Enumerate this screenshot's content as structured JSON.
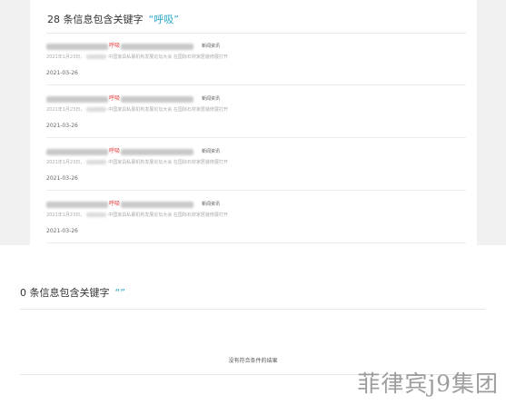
{
  "section1": {
    "count_label": "28 条信息包含关键字",
    "keyword": "“呼吸”"
  },
  "results": [
    {
      "highlight": "呼吸",
      "category": "新闻资讯",
      "snippet_start": "2021年1月23日，",
      "snippet_mid": "中国家具私募机构发展论坛大会",
      "snippet_end": "在国际石材家居装修展打开",
      "date": "2021-03-26"
    },
    {
      "highlight": "呼吸",
      "category": "新闻资讯",
      "snippet_start": "2021年1月23日，",
      "snippet_mid": "中国家具私募机构发展论坛大会",
      "snippet_end": "在国际石材家居装修展打开",
      "date": "2021-03-26"
    },
    {
      "highlight": "呼吸",
      "category": "新闻资讯",
      "snippet_start": "2021年1月23日，",
      "snippet_mid": "中国家具私募机构发展论坛大会",
      "snippet_end": "在国际石材家居装修展打开",
      "date": "2021-03-26"
    },
    {
      "highlight": "呼吸",
      "category": "新闻资讯",
      "snippet_start": "2021年1月23日，",
      "snippet_mid": "中国家具私募机构发展论坛大会",
      "snippet_end": "在国际石材家居装修展打开",
      "date": "2021-03-26"
    }
  ],
  "section2": {
    "count_label": "0 条信息包含关键字",
    "keyword": "“”",
    "empty_message": "没有符合条件的结果"
  },
  "watermark": "菲律宾j9集团"
}
